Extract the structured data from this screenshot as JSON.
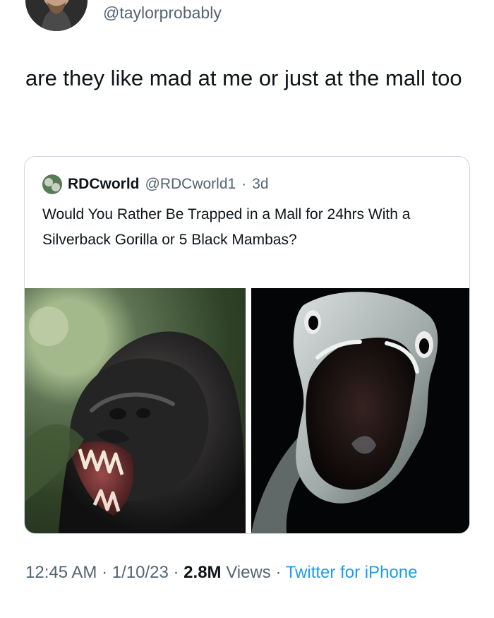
{
  "author": {
    "handle": "@taylorprobably"
  },
  "tweet": {
    "text": "are they like mad at me or just at the mall too"
  },
  "quote": {
    "name": "RDCworld",
    "handle": "@RDCworld1",
    "separator": "·",
    "age": "3d",
    "text": "Would You Rather Be Trapped in a Mall for 24hrs With a Silverback Gorilla or 5 Black Mambas?"
  },
  "meta": {
    "time": "12:45 AM",
    "date": "1/10/23",
    "views_value": "2.8M",
    "views_label": "Views",
    "source": "Twitter for iPhone",
    "separator": "·"
  }
}
